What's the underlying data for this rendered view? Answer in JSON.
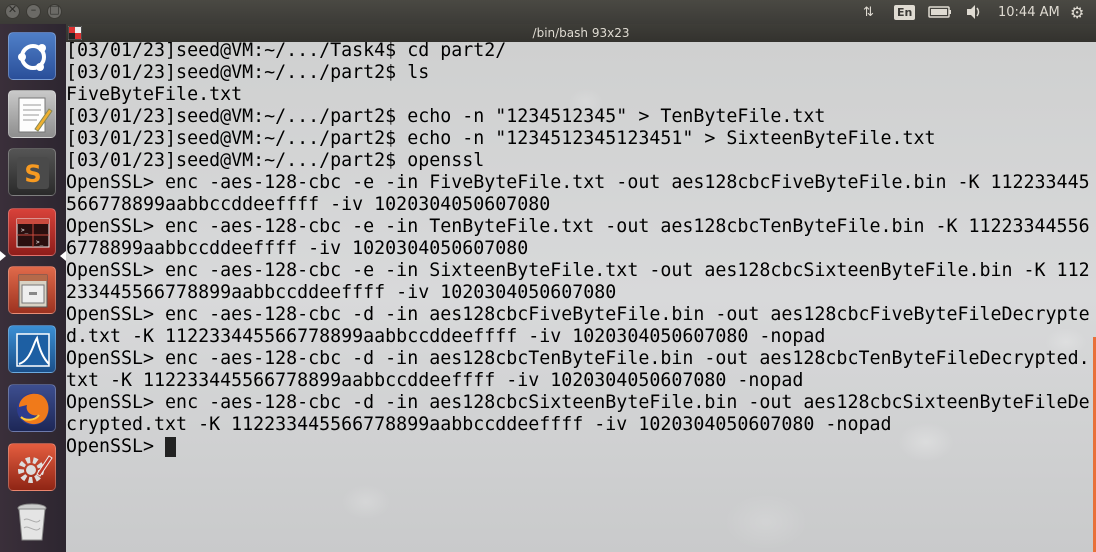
{
  "top_panel": {
    "language": "En",
    "clock": "10:44 AM"
  },
  "launcher": {
    "items": [
      {
        "name": "ubuntu-dash",
        "icon": "ubuntu-logo-icon"
      },
      {
        "name": "text-editor",
        "icon": "text-editor-icon"
      },
      {
        "name": "sublime-text",
        "icon": "sublime-text-icon"
      },
      {
        "name": "terminal",
        "icon": "terminal-icon"
      },
      {
        "name": "files",
        "icon": "file-cabinet-icon"
      },
      {
        "name": "wireshark",
        "icon": "wireshark-fin-icon"
      },
      {
        "name": "firefox",
        "icon": "firefox-icon"
      },
      {
        "name": "system-settings",
        "icon": "settings-gear-icon"
      },
      {
        "name": "trash",
        "icon": "trash-icon"
      }
    ]
  },
  "terminal": {
    "title": "/bin/bash 93x23",
    "lines": [
      "[03/01/23]seed@VM:~/.../Task4$ cd part2/",
      "[03/01/23]seed@VM:~/.../part2$ ls",
      "FiveByteFile.txt",
      "[03/01/23]seed@VM:~/.../part2$ echo -n \"1234512345\" > TenByteFile.txt",
      "[03/01/23]seed@VM:~/.../part2$ echo -n \"1234512345123451\" > SixteenByteFile.txt",
      "[03/01/23]seed@VM:~/.../part2$ openssl",
      "OpenSSL> enc -aes-128-cbc -e -in FiveByteFile.txt -out aes128cbcFiveByteFile.bin -K 112233445",
      "566778899aabbccddeeffff -iv 1020304050607080",
      "OpenSSL> enc -aes-128-cbc -e -in TenByteFile.txt -out aes128cbcTenByteFile.bin -K 11223344556",
      "6778899aabbccddeeffff -iv 1020304050607080",
      "OpenSSL> enc -aes-128-cbc -e -in SixteenByteFile.txt -out aes128cbcSixteenByteFile.bin -K 112",
      "233445566778899aabbccddeeffff -iv 1020304050607080",
      "OpenSSL> enc -aes-128-cbc -d -in aes128cbcFiveByteFile.bin -out aes128cbcFiveByteFileDecrypte",
      "d.txt -K 112233445566778899aabbccddeeffff -iv 1020304050607080 -nopad",
      "OpenSSL> enc -aes-128-cbc -d -in aes128cbcTenByteFile.bin -out aes128cbcTenByteFileDecrypted.",
      "txt -K 112233445566778899aabbccddeeffff -iv 1020304050607080 -nopad",
      "OpenSSL> enc -aes-128-cbc -d -in aes128cbcSixteenByteFile.bin -out aes128cbcSixteenByteFileDe",
      "crypted.txt -K 112233445566778899aabbccddeeffff -iv 1020304050607080 -nopad"
    ],
    "prompt": "OpenSSL> "
  }
}
